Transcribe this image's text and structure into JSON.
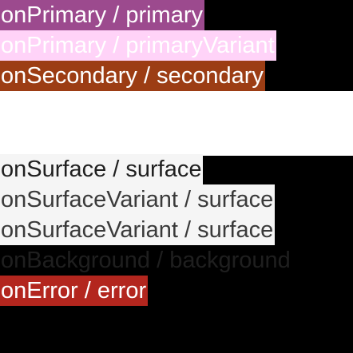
{
  "colors": {
    "top_background": "#000000",
    "middle_background": "#ffffff",
    "bottom_background": "#000000",
    "primary": "#9c4a8e",
    "on_primary": "#ffffff",
    "primary_variant": "#ffd3f8",
    "on_primary_variant": "#ffffff",
    "secondary": "#9c3d14",
    "on_secondary": "#ffffff",
    "surface": "#f5f5f5",
    "on_surface": "#1f1f1f",
    "surface_variant": "#f5f5f5",
    "on_surface_variant": "#3a3a3a",
    "background": "#000000",
    "on_background": "#1f1f1f",
    "error": "#b3261e",
    "on_error": "#ffffff"
  },
  "swatches": {
    "primary": {
      "label": "onPrimary / primary"
    },
    "primary_variant": {
      "label": "onPrimary / primaryVariant"
    },
    "secondary": {
      "label": "onSecondary / secondary"
    },
    "surface": {
      "label": "onSurface / surface"
    },
    "surface_variant_1": {
      "label": "onSurfaceVariant / surface"
    },
    "surface_variant_2": {
      "label": "onSurfaceVariant / surface"
    },
    "background": {
      "label": "onBackground / background"
    },
    "error": {
      "label": "onError / error"
    }
  }
}
